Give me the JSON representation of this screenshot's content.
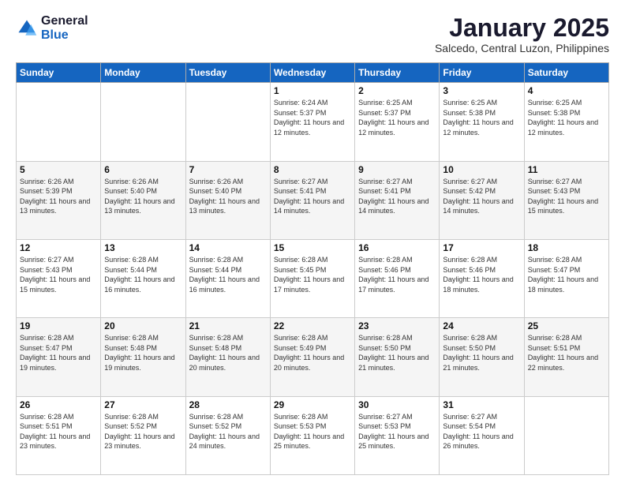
{
  "logo": {
    "general": "General",
    "blue": "Blue"
  },
  "header": {
    "month": "January 2025",
    "location": "Salcedo, Central Luzon, Philippines"
  },
  "weekdays": [
    "Sunday",
    "Monday",
    "Tuesday",
    "Wednesday",
    "Thursday",
    "Friday",
    "Saturday"
  ],
  "weeks": [
    [
      {
        "day": "",
        "sunrise": "",
        "sunset": "",
        "daylight": ""
      },
      {
        "day": "",
        "sunrise": "",
        "sunset": "",
        "daylight": ""
      },
      {
        "day": "",
        "sunrise": "",
        "sunset": "",
        "daylight": ""
      },
      {
        "day": "1",
        "sunrise": "Sunrise: 6:24 AM",
        "sunset": "Sunset: 5:37 PM",
        "daylight": "Daylight: 11 hours and 12 minutes."
      },
      {
        "day": "2",
        "sunrise": "Sunrise: 6:25 AM",
        "sunset": "Sunset: 5:37 PM",
        "daylight": "Daylight: 11 hours and 12 minutes."
      },
      {
        "day": "3",
        "sunrise": "Sunrise: 6:25 AM",
        "sunset": "Sunset: 5:38 PM",
        "daylight": "Daylight: 11 hours and 12 minutes."
      },
      {
        "day": "4",
        "sunrise": "Sunrise: 6:25 AM",
        "sunset": "Sunset: 5:38 PM",
        "daylight": "Daylight: 11 hours and 12 minutes."
      }
    ],
    [
      {
        "day": "5",
        "sunrise": "Sunrise: 6:26 AM",
        "sunset": "Sunset: 5:39 PM",
        "daylight": "Daylight: 11 hours and 13 minutes."
      },
      {
        "day": "6",
        "sunrise": "Sunrise: 6:26 AM",
        "sunset": "Sunset: 5:40 PM",
        "daylight": "Daylight: 11 hours and 13 minutes."
      },
      {
        "day": "7",
        "sunrise": "Sunrise: 6:26 AM",
        "sunset": "Sunset: 5:40 PM",
        "daylight": "Daylight: 11 hours and 13 minutes."
      },
      {
        "day": "8",
        "sunrise": "Sunrise: 6:27 AM",
        "sunset": "Sunset: 5:41 PM",
        "daylight": "Daylight: 11 hours and 14 minutes."
      },
      {
        "day": "9",
        "sunrise": "Sunrise: 6:27 AM",
        "sunset": "Sunset: 5:41 PM",
        "daylight": "Daylight: 11 hours and 14 minutes."
      },
      {
        "day": "10",
        "sunrise": "Sunrise: 6:27 AM",
        "sunset": "Sunset: 5:42 PM",
        "daylight": "Daylight: 11 hours and 14 minutes."
      },
      {
        "day": "11",
        "sunrise": "Sunrise: 6:27 AM",
        "sunset": "Sunset: 5:43 PM",
        "daylight": "Daylight: 11 hours and 15 minutes."
      }
    ],
    [
      {
        "day": "12",
        "sunrise": "Sunrise: 6:27 AM",
        "sunset": "Sunset: 5:43 PM",
        "daylight": "Daylight: 11 hours and 15 minutes."
      },
      {
        "day": "13",
        "sunrise": "Sunrise: 6:28 AM",
        "sunset": "Sunset: 5:44 PM",
        "daylight": "Daylight: 11 hours and 16 minutes."
      },
      {
        "day": "14",
        "sunrise": "Sunrise: 6:28 AM",
        "sunset": "Sunset: 5:44 PM",
        "daylight": "Daylight: 11 hours and 16 minutes."
      },
      {
        "day": "15",
        "sunrise": "Sunrise: 6:28 AM",
        "sunset": "Sunset: 5:45 PM",
        "daylight": "Daylight: 11 hours and 17 minutes."
      },
      {
        "day": "16",
        "sunrise": "Sunrise: 6:28 AM",
        "sunset": "Sunset: 5:46 PM",
        "daylight": "Daylight: 11 hours and 17 minutes."
      },
      {
        "day": "17",
        "sunrise": "Sunrise: 6:28 AM",
        "sunset": "Sunset: 5:46 PM",
        "daylight": "Daylight: 11 hours and 18 minutes."
      },
      {
        "day": "18",
        "sunrise": "Sunrise: 6:28 AM",
        "sunset": "Sunset: 5:47 PM",
        "daylight": "Daylight: 11 hours and 18 minutes."
      }
    ],
    [
      {
        "day": "19",
        "sunrise": "Sunrise: 6:28 AM",
        "sunset": "Sunset: 5:47 PM",
        "daylight": "Daylight: 11 hours and 19 minutes."
      },
      {
        "day": "20",
        "sunrise": "Sunrise: 6:28 AM",
        "sunset": "Sunset: 5:48 PM",
        "daylight": "Daylight: 11 hours and 19 minutes."
      },
      {
        "day": "21",
        "sunrise": "Sunrise: 6:28 AM",
        "sunset": "Sunset: 5:48 PM",
        "daylight": "Daylight: 11 hours and 20 minutes."
      },
      {
        "day": "22",
        "sunrise": "Sunrise: 6:28 AM",
        "sunset": "Sunset: 5:49 PM",
        "daylight": "Daylight: 11 hours and 20 minutes."
      },
      {
        "day": "23",
        "sunrise": "Sunrise: 6:28 AM",
        "sunset": "Sunset: 5:50 PM",
        "daylight": "Daylight: 11 hours and 21 minutes."
      },
      {
        "day": "24",
        "sunrise": "Sunrise: 6:28 AM",
        "sunset": "Sunset: 5:50 PM",
        "daylight": "Daylight: 11 hours and 21 minutes."
      },
      {
        "day": "25",
        "sunrise": "Sunrise: 6:28 AM",
        "sunset": "Sunset: 5:51 PM",
        "daylight": "Daylight: 11 hours and 22 minutes."
      }
    ],
    [
      {
        "day": "26",
        "sunrise": "Sunrise: 6:28 AM",
        "sunset": "Sunset: 5:51 PM",
        "daylight": "Daylight: 11 hours and 23 minutes."
      },
      {
        "day": "27",
        "sunrise": "Sunrise: 6:28 AM",
        "sunset": "Sunset: 5:52 PM",
        "daylight": "Daylight: 11 hours and 23 minutes."
      },
      {
        "day": "28",
        "sunrise": "Sunrise: 6:28 AM",
        "sunset": "Sunset: 5:52 PM",
        "daylight": "Daylight: 11 hours and 24 minutes."
      },
      {
        "day": "29",
        "sunrise": "Sunrise: 6:28 AM",
        "sunset": "Sunset: 5:53 PM",
        "daylight": "Daylight: 11 hours and 25 minutes."
      },
      {
        "day": "30",
        "sunrise": "Sunrise: 6:27 AM",
        "sunset": "Sunset: 5:53 PM",
        "daylight": "Daylight: 11 hours and 25 minutes."
      },
      {
        "day": "31",
        "sunrise": "Sunrise: 6:27 AM",
        "sunset": "Sunset: 5:54 PM",
        "daylight": "Daylight: 11 hours and 26 minutes."
      },
      {
        "day": "",
        "sunrise": "",
        "sunset": "",
        "daylight": ""
      }
    ]
  ]
}
